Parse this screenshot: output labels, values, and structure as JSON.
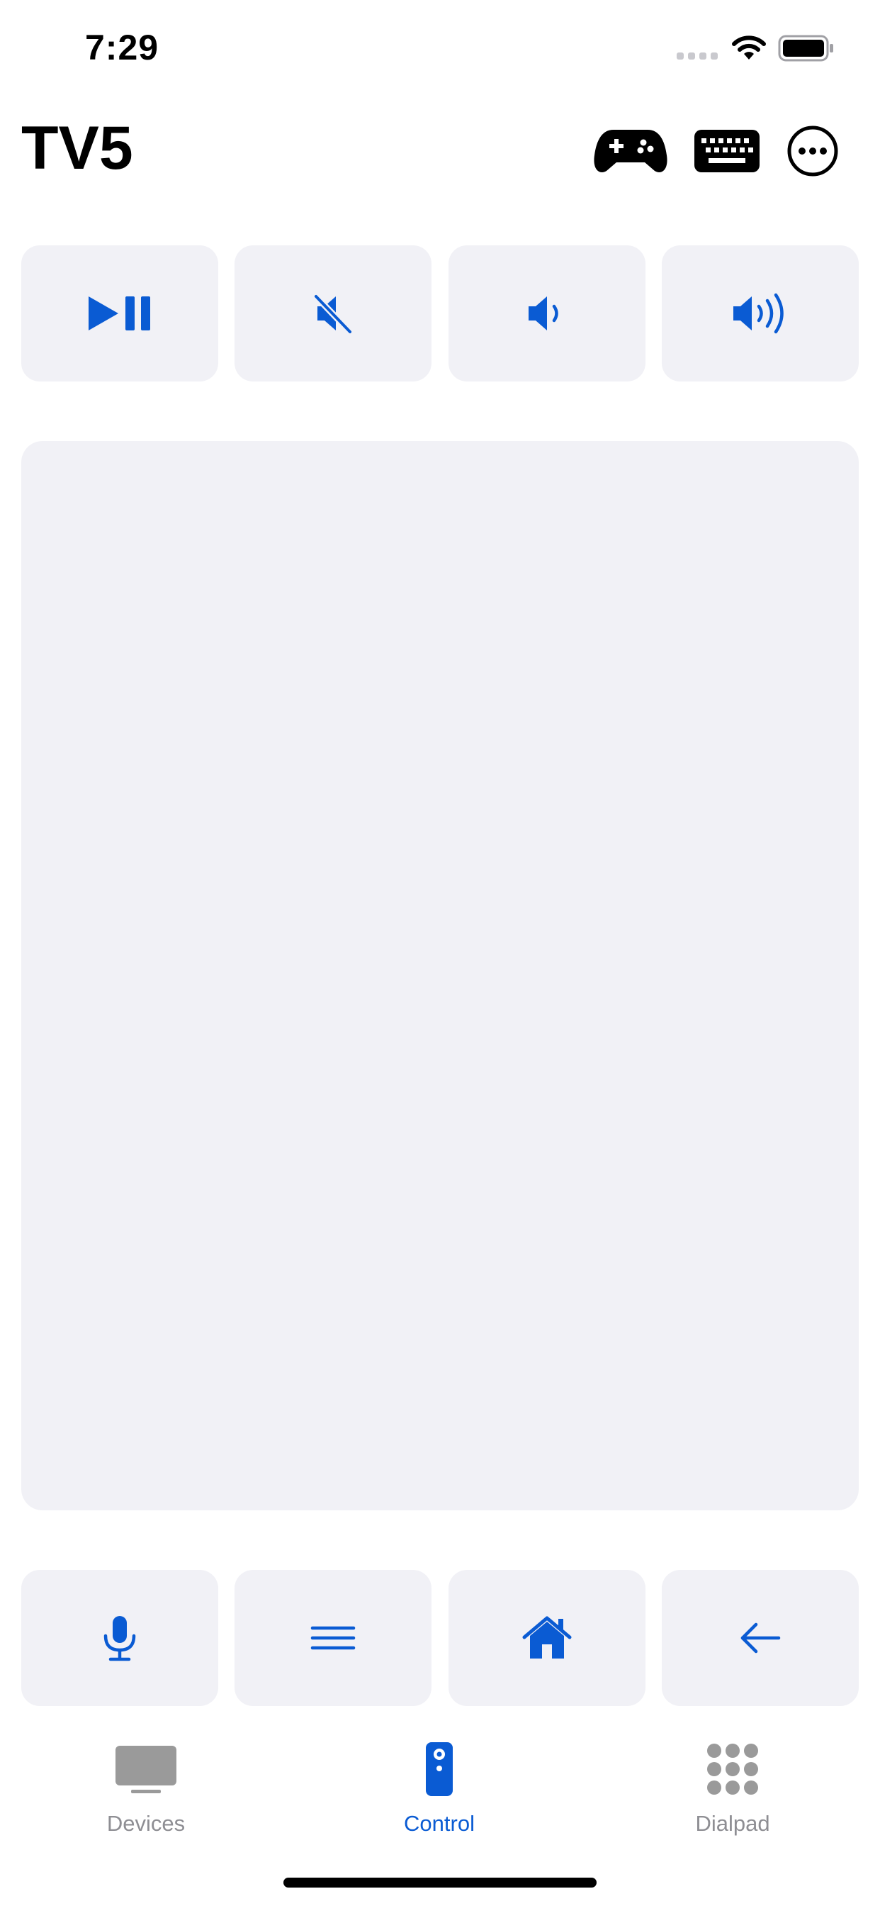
{
  "status_bar": {
    "time": "7:29"
  },
  "header": {
    "title": "TV5"
  },
  "colors": {
    "accent": "#0a5bd3",
    "tile_background": "#f1f1f6",
    "inactive": "#8e8e93"
  },
  "top_controls": [
    {
      "icon": "play-pause-icon"
    },
    {
      "icon": "mute-icon"
    },
    {
      "icon": "volume-down-icon"
    },
    {
      "icon": "volume-up-icon"
    }
  ],
  "bottom_controls": [
    {
      "icon": "microphone-icon"
    },
    {
      "icon": "menu-icon"
    },
    {
      "icon": "home-icon"
    },
    {
      "icon": "back-arrow-icon"
    }
  ],
  "tab_bar": {
    "devices_label": "Devices",
    "control_label": "Control",
    "dialpad_label": "Dialpad",
    "active_tab": "Control"
  }
}
